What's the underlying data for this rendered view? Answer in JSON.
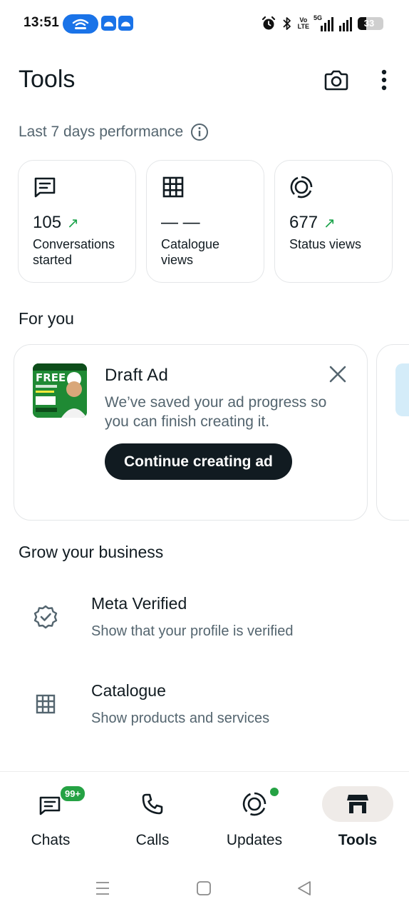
{
  "status_bar": {
    "time": "13:51",
    "volte_top": "Vo",
    "volte_bottom": "LTE",
    "network": "5G",
    "battery": "33",
    "battery_level": 0.33
  },
  "header": {
    "title": "Tools"
  },
  "performance": {
    "title": "Last 7 days performance",
    "cards": [
      {
        "icon": "message-icon",
        "value": "105",
        "label_line1": "Conversations",
        "label_line2": "started",
        "trend": "up"
      },
      {
        "icon": "grid-icon",
        "value": "— —",
        "label_line1": "Catalogue",
        "label_line2": "views",
        "trend": ""
      },
      {
        "icon": "status-icon",
        "value": "677",
        "label_line1": "Status views",
        "label_line2": "",
        "trend": "up"
      }
    ]
  },
  "for_you": {
    "title": "For you",
    "ad": {
      "name": "Draft Ad",
      "description": "We’ve saved your ad progress so you can finish creating it.",
      "button": "Continue creating ad",
      "thumb_text": "FREE"
    }
  },
  "grow": {
    "title": "Grow your business",
    "items": [
      {
        "icon": "verified-badge-icon",
        "title": "Meta Verified",
        "subtitle": "Show that your profile is verified"
      },
      {
        "icon": "grid-icon",
        "title": "Catalogue",
        "subtitle": "Show products and services"
      }
    ]
  },
  "nav": {
    "items": [
      {
        "label": "Chats",
        "icon": "chats-icon",
        "badge": "99+"
      },
      {
        "label": "Calls",
        "icon": "phone-icon"
      },
      {
        "label": "Updates",
        "icon": "updates-icon"
      },
      {
        "label": "Tools",
        "icon": "store-icon",
        "active": true
      }
    ]
  },
  "colors": {
    "accent_green": "#25a244",
    "trend_green": "#1aa34a",
    "text_primary": "#111b21",
    "text_secondary": "#54656f",
    "status_pill": "#1a73e8"
  }
}
